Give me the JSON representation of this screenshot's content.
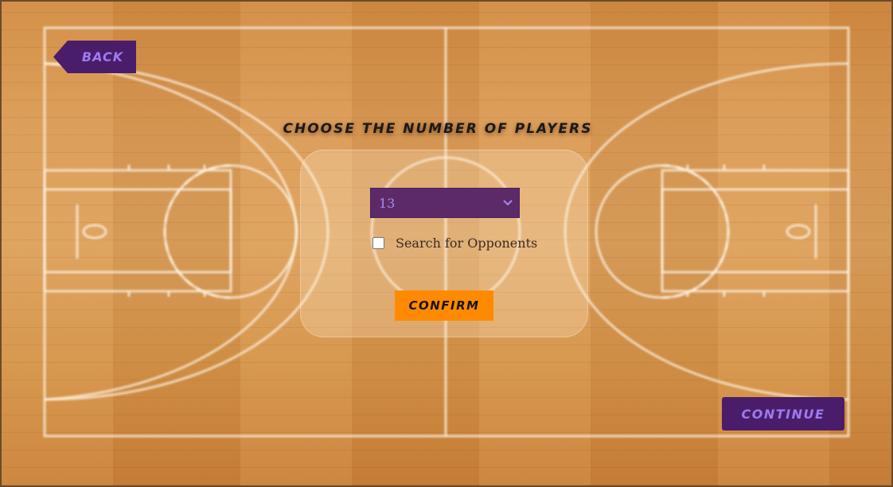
{
  "nav": {
    "back_label": "BACK",
    "continue_label": "CONTINUE"
  },
  "main": {
    "heading": "CHOOSE THE NUMBER OF PLAYERS",
    "player_select": {
      "selected_value": "13"
    },
    "search_opponents": {
      "label": "Search for Opponents",
      "checked": false
    },
    "confirm_label": "CONFIRM"
  },
  "icons": {
    "select_arrow": "chevron-down-icon"
  },
  "colors": {
    "purple": "#4a1d6a",
    "purple_text": "#9b7cf0",
    "orange": "#ff8a00",
    "court_wood": "#d99a55",
    "court_lines": "#ffffff"
  }
}
